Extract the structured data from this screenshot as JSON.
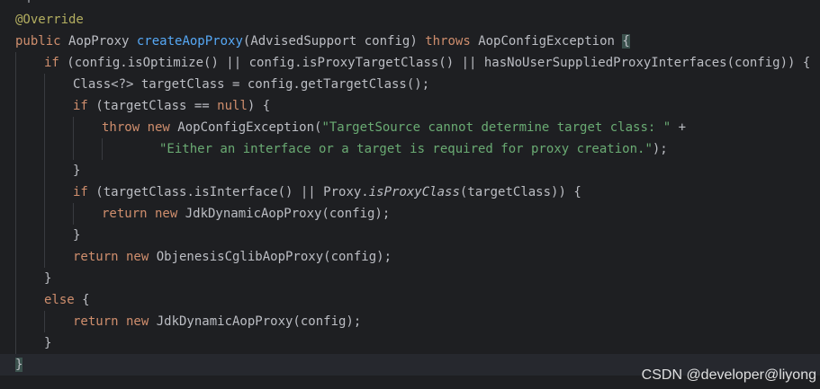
{
  "editor": {
    "colors": {
      "background": "#1e1f22",
      "keyword": "#cf8e6d",
      "method": "#56a8f5",
      "annotation": "#b3ae60",
      "string": "#6aab73",
      "default": "#bcbec4"
    },
    "lines": [
      {
        "indent": 0,
        "tokens": [
          {
            "t": "ann",
            "v": "@Override"
          }
        ]
      },
      {
        "indent": 0,
        "tokens": [
          {
            "t": "kw",
            "v": "public "
          },
          {
            "t": "plain",
            "v": "AopProxy "
          },
          {
            "t": "fn",
            "v": "createAopProxy"
          },
          {
            "t": "plain",
            "v": "(AdvisedSupport config) "
          },
          {
            "t": "kw",
            "v": "throws "
          },
          {
            "t": "plain",
            "v": "AopConfigException "
          },
          {
            "t": "brace",
            "v": "{"
          }
        ]
      },
      {
        "indent": 1,
        "tokens": [
          {
            "t": "kw",
            "v": "if "
          },
          {
            "t": "plain",
            "v": "(config.isOptimize() || config.isProxyTargetClass() || hasNoUserSuppliedProxyInterfaces(config)) {"
          }
        ]
      },
      {
        "indent": 2,
        "tokens": [
          {
            "t": "plain",
            "v": "Class<?> targetClass = config.getTargetClass();"
          }
        ]
      },
      {
        "indent": 2,
        "tokens": [
          {
            "t": "kw",
            "v": "if "
          },
          {
            "t": "plain",
            "v": "(targetClass == "
          },
          {
            "t": "kw",
            "v": "null"
          },
          {
            "t": "plain",
            "v": ") {"
          }
        ]
      },
      {
        "indent": 3,
        "tokens": [
          {
            "t": "kw",
            "v": "throw new "
          },
          {
            "t": "plain",
            "v": "AopConfigException("
          },
          {
            "t": "str",
            "v": "\"TargetSource cannot determine target class: \""
          },
          {
            "t": "plain",
            "v": " +"
          }
        ]
      },
      {
        "indent": 5,
        "tokens": [
          {
            "t": "str",
            "v": "\"Either an interface or a target is required for proxy creation.\""
          },
          {
            "t": "plain",
            "v": ");"
          }
        ]
      },
      {
        "indent": 2,
        "tokens": [
          {
            "t": "plain",
            "v": "}"
          }
        ]
      },
      {
        "indent": 2,
        "tokens": [
          {
            "t": "kw",
            "v": "if "
          },
          {
            "t": "plain",
            "v": "(targetClass.isInterface() || Proxy."
          },
          {
            "t": "st",
            "v": "isProxyClass"
          },
          {
            "t": "plain",
            "v": "(targetClass)) {"
          }
        ]
      },
      {
        "indent": 3,
        "tokens": [
          {
            "t": "kw",
            "v": "return new "
          },
          {
            "t": "plain",
            "v": "JdkDynamicAopProxy(config);"
          }
        ]
      },
      {
        "indent": 2,
        "tokens": [
          {
            "t": "plain",
            "v": "}"
          }
        ]
      },
      {
        "indent": 2,
        "tokens": [
          {
            "t": "kw",
            "v": "return new "
          },
          {
            "t": "plain",
            "v": "ObjenesisCglibAopProxy(config);"
          }
        ]
      },
      {
        "indent": 1,
        "tokens": [
          {
            "t": "plain",
            "v": "}"
          }
        ]
      },
      {
        "indent": 1,
        "tokens": [
          {
            "t": "kw",
            "v": "else "
          },
          {
            "t": "plain",
            "v": "{"
          }
        ]
      },
      {
        "indent": 2,
        "tokens": [
          {
            "t": "kw",
            "v": "return new "
          },
          {
            "t": "plain",
            "v": "JdkDynamicAopProxy(config);"
          }
        ]
      },
      {
        "indent": 1,
        "tokens": [
          {
            "t": "plain",
            "v": "}"
          }
        ]
      },
      {
        "indent": 0,
        "current": true,
        "tokens": [
          {
            "t": "brace",
            "v": "}"
          }
        ]
      }
    ]
  },
  "watermark": "CSDN @developer@liyong"
}
